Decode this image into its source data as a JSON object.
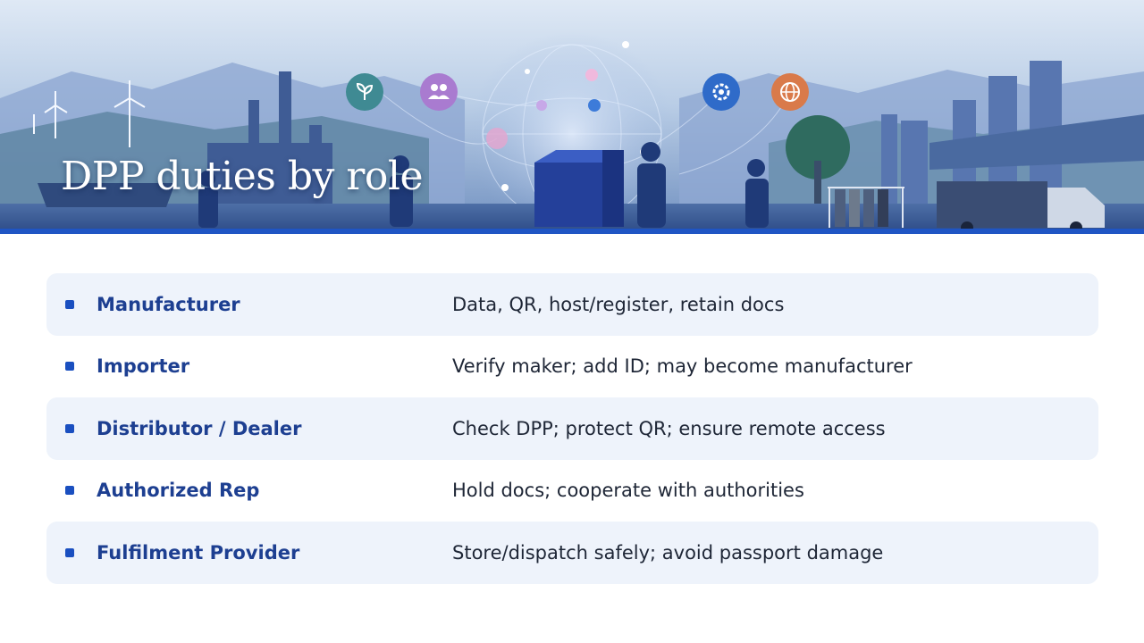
{
  "slide": {
    "title": "DPP duties by role"
  },
  "colors": {
    "accent": "#1f55c4",
    "role_text": "#1d3f91",
    "row_shade": "#eef3fb"
  },
  "roles": [
    {
      "name": "Manufacturer",
      "duty": "Data, QR, host/register, retain docs"
    },
    {
      "name": "Importer",
      "duty": "Verify maker; add ID; may become manufacturer"
    },
    {
      "name": "Distributor / Dealer",
      "duty": "Check DPP; protect QR; ensure remote access"
    },
    {
      "name": "Authorized Rep",
      "duty": "Hold docs; cooperate with authorities"
    },
    {
      "name": "Fulfilment Provider",
      "duty": "Store/dispatch safely; avoid passport damage"
    }
  ],
  "banner_icons": [
    "leaf-icon",
    "people-icon",
    "gear-icon",
    "globe-icon"
  ]
}
